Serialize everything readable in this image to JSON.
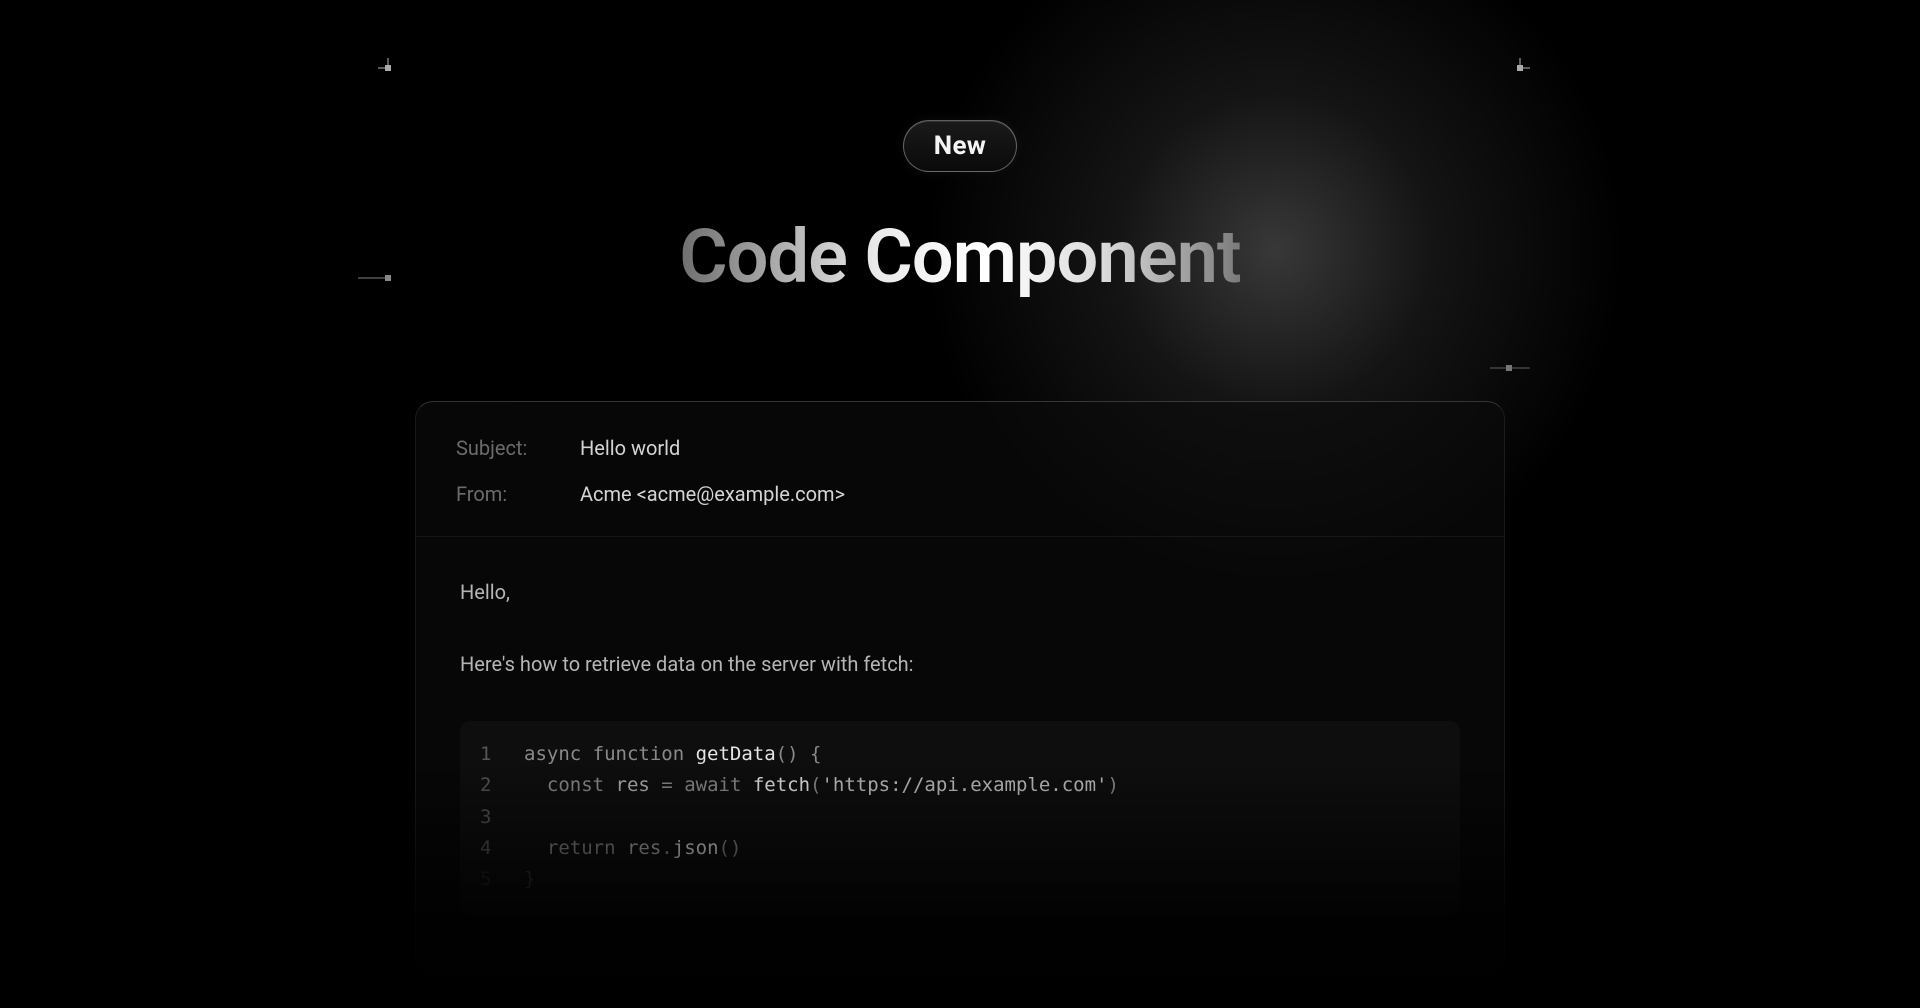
{
  "badge": {
    "label": "New"
  },
  "title": "Code Component",
  "email": {
    "subject_label": "Subject:",
    "subject_value": "Hello world",
    "from_label": "From:",
    "from_value": "Acme <acme@example.com>",
    "greeting": "Hello,",
    "intro": "Here's how to retrieve data on the server with fetch:"
  },
  "code": {
    "lines": [
      {
        "n": "1",
        "indent": "",
        "tokens": [
          {
            "t": "async ",
            "c": "tok-keyword"
          },
          {
            "t": "function ",
            "c": "tok-keyword"
          },
          {
            "t": "getData",
            "c": "tok-fn"
          },
          {
            "t": "() {",
            "c": "tok-punct"
          }
        ]
      },
      {
        "n": "2",
        "indent": "  ",
        "tokens": [
          {
            "t": "const ",
            "c": "tok-keyword"
          },
          {
            "t": "res ",
            "c": "tok-ident"
          },
          {
            "t": "= ",
            "c": "tok-punct"
          },
          {
            "t": "await ",
            "c": "tok-keyword"
          },
          {
            "t": "fetch",
            "c": "tok-fn"
          },
          {
            "t": "(",
            "c": "tok-punct"
          },
          {
            "t": "'https://api.example.com'",
            "c": "tok-str"
          },
          {
            "t": ")",
            "c": "tok-punct"
          }
        ]
      },
      {
        "n": "3",
        "indent": "",
        "tokens": []
      },
      {
        "n": "4",
        "indent": "  ",
        "tokens": [
          {
            "t": "return ",
            "c": "tok-keyword"
          },
          {
            "t": "res",
            "c": "tok-ident"
          },
          {
            "t": ".",
            "c": "tok-punct"
          },
          {
            "t": "json",
            "c": "tok-fn"
          },
          {
            "t": "()",
            "c": "tok-punct"
          }
        ]
      },
      {
        "n": "5",
        "indent": "",
        "faded": true,
        "tokens": [
          {
            "t": "}",
            "c": "tok-punct"
          }
        ]
      }
    ]
  }
}
